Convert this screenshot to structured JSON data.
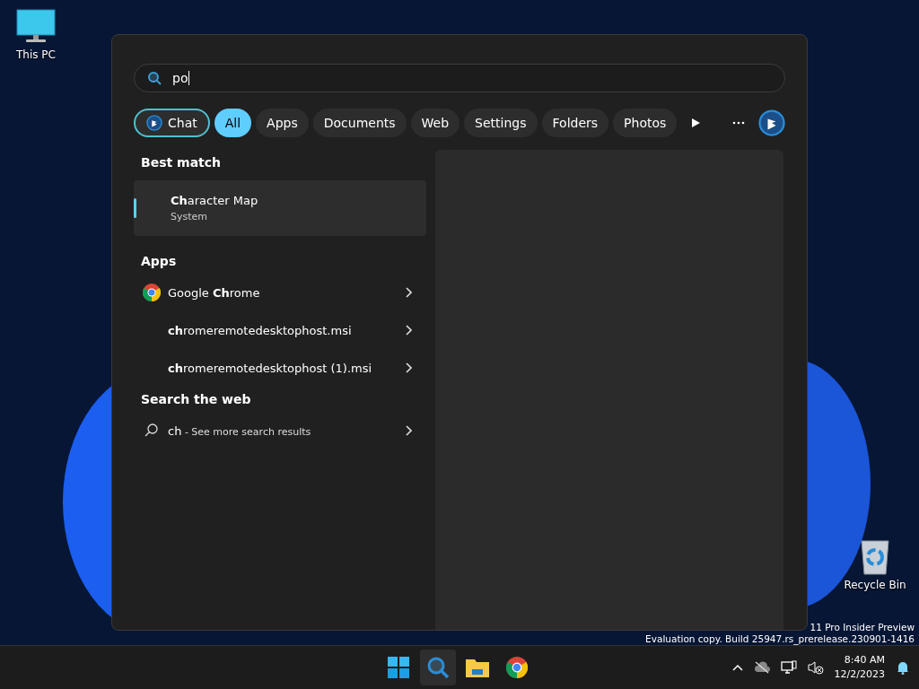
{
  "desktop_icons": [
    {
      "kind": "pc",
      "label": "This PC"
    },
    {
      "kind": "bin",
      "label": "Recycle Bin"
    }
  ],
  "search": {
    "value": "po"
  },
  "filters": [
    {
      "label": "Chat",
      "kind": "chat",
      "selected": false
    },
    {
      "label": "All",
      "kind": "plain",
      "selected": true
    },
    {
      "label": "Apps",
      "kind": "plain",
      "selected": false
    },
    {
      "label": "Documents",
      "kind": "plain",
      "selected": false
    },
    {
      "label": "Web",
      "kind": "plain",
      "selected": false
    },
    {
      "label": "Settings",
      "kind": "plain",
      "selected": false
    },
    {
      "label": "Folders",
      "kind": "plain",
      "selected": false
    },
    {
      "label": "Photos",
      "kind": "plain",
      "selected": false
    }
  ],
  "best_match": {
    "heading": "Best match",
    "title": "**Ch**aracter Map",
    "subtitle": "System",
    "selected": true
  },
  "apps": {
    "heading": "Apps",
    "items": [
      {
        "label": "Google **Ch**rome",
        "kind": "chrome"
      },
      {
        "label": "**ch**romeremotedesktophost.msi",
        "kind": "file"
      },
      {
        "label": "**ch**romeremotedesktophost (1).msi",
        "kind": "file"
      }
    ]
  },
  "web": {
    "heading": "Search the web",
    "query": "ch",
    "suffix": " - See more search results"
  },
  "watermark": [
    "11 Pro Insider Preview",
    "Evaluation copy. Build 25947.rs_prerelease.230901-1416"
  ],
  "taskbar": {
    "apps": [
      {
        "kind": "start",
        "selected": false
      },
      {
        "kind": "search",
        "selected": true
      },
      {
        "kind": "folder",
        "selected": false
      },
      {
        "kind": "chrome",
        "selected": false
      }
    ],
    "time": "8:40 AM",
    "date": "12/2/2023"
  }
}
